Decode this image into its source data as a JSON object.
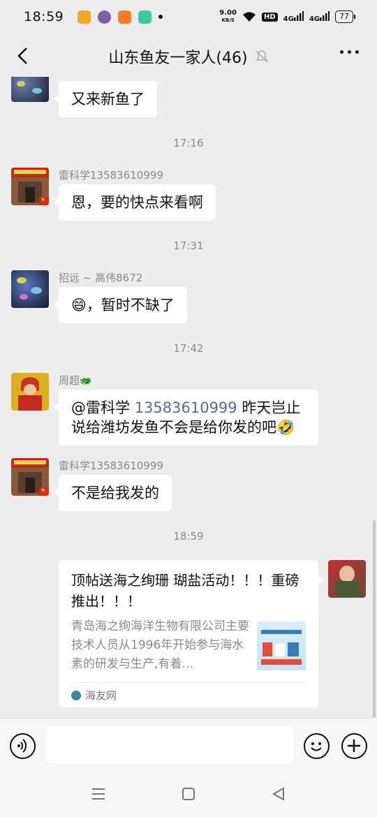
{
  "status": {
    "time": "18:59",
    "net_speed_value": "9.00",
    "net_speed_unit": "KB/S",
    "hd": "HD",
    "sig1": "4G",
    "sig2": "4G",
    "battery": "77",
    "app_colors": [
      "#f5a623",
      "#7b5ea7",
      "#ff7b1c",
      "#3cc8a0"
    ]
  },
  "nav": {
    "title": "山东鱼友一家人(46)"
  },
  "chat": {
    "msg0": {
      "text": "又来新鱼了"
    },
    "time1": "17:16",
    "msg1": {
      "sender": "雷科学13583610999",
      "text": "恩，要的快点来看啊"
    },
    "time2": "17:31",
    "msg2": {
      "sender": "招远 ~ 高伟8672",
      "emoji": "😄",
      "text": "，暂时不缺了"
    },
    "time3": "17:42",
    "msg3": {
      "sender": "周超",
      "sender_emoji": "🐲",
      "mention": "@雷科学",
      "mention_phone": "13583610999",
      "line1_rest": " 昨天岂止",
      "line2": "说给潍坊发鱼不会是给你发的吧",
      "line2_emoji": "🤣"
    },
    "msg4": {
      "sender": "雷科学13583610999",
      "text": "不是给我发的"
    },
    "time4": "18:59",
    "card": {
      "title": "顶帖送海之绚珊 瑚盐活动！！！重磅推出！！！",
      "desc": "青岛海之绚海洋生物有限公司主要技术人员从1996年开始参与海水素的研发与生产,有着…",
      "source": "海友网"
    }
  },
  "input": {
    "placeholder": ""
  }
}
